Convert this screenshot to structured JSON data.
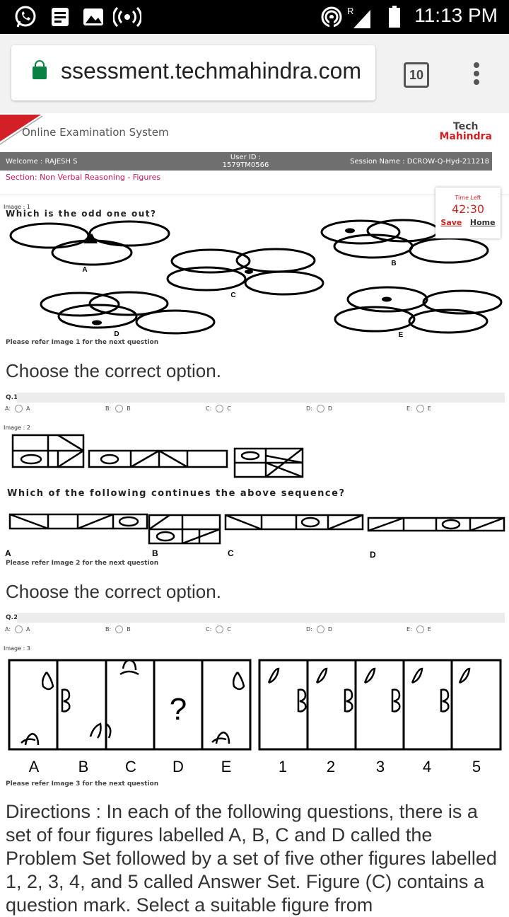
{
  "status_bar": {
    "time": "11:13 PM",
    "roaming": "R",
    "icons": [
      "whatsapp-icon",
      "notes-icon",
      "gallery-icon",
      "radio-icon",
      "hotspot-icon",
      "signal-icon",
      "battery-icon"
    ]
  },
  "browser": {
    "url": "ssessment.techmahindra.com",
    "tab_count": "10"
  },
  "header": {
    "app_title": "Online Examination System",
    "logo_line1": "Tech",
    "logo_line2": "Mahindra"
  },
  "info_bar": {
    "welcome": "Welcome : RAJESH S",
    "user_id_label": "User ID :",
    "user_id": "1579TM0566",
    "session": "Session Name : DCROW-Q-Hyd-211218"
  },
  "section": "Section: Non Verbal Reasoning - Figures",
  "timer": {
    "label": "Time Left",
    "value": "42:30",
    "save": "Save",
    "home": "Home"
  },
  "image1": {
    "label": "Image : 1",
    "question": "Which is the odd one out?",
    "figure_labels": [
      "A",
      "B",
      "C",
      "D",
      "E"
    ],
    "refer": "Please refer Image 1 for the next question"
  },
  "choose_text": "Choose the correct option.",
  "q1": {
    "number": "Q.1",
    "options": [
      {
        "key": "A:",
        "value": "A"
      },
      {
        "key": "B:",
        "value": "B"
      },
      {
        "key": "C:",
        "value": "C"
      },
      {
        "key": "D:",
        "value": "D"
      },
      {
        "key": "E:",
        "value": "E"
      }
    ]
  },
  "image2": {
    "label": "Image : 2",
    "question": "Which of the following continues the above sequence?",
    "figure_labels": [
      "A",
      "B",
      "C",
      "D"
    ],
    "refer": "Please refer Image 2 for the next question"
  },
  "q2": {
    "number": "Q.2",
    "options": [
      {
        "key": "A:",
        "value": "A"
      },
      {
        "key": "B:",
        "value": "B"
      },
      {
        "key": "C:",
        "value": "C"
      },
      {
        "key": "D:",
        "value": "D"
      },
      {
        "key": "E:",
        "value": "E"
      }
    ]
  },
  "image3": {
    "label": "Image : 3",
    "problem_labels": [
      "A",
      "B",
      "C",
      "D",
      "E"
    ],
    "answer_labels": [
      "1",
      "2",
      "3",
      "4",
      "5"
    ],
    "question_mark": "?",
    "refer": "Please refer Image 3 for the next question"
  },
  "directions": "Directions : In each of the following questions, there is a set of four figures labelled A, B, C and D called the Problem Set followed by a set of five other figures labelled 1, 2, 3, 4, and 5 called Answer Set. Figure (C) contains a question mark. Select a suitable figure from"
}
